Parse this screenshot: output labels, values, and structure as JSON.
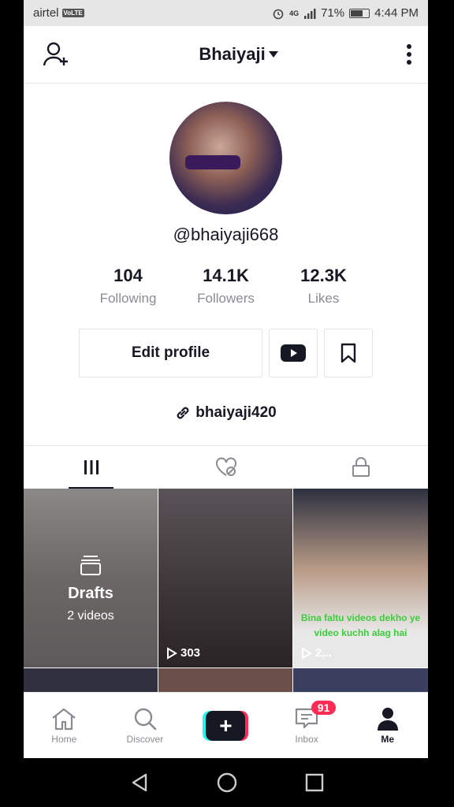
{
  "status": {
    "carrier": "airtel",
    "volte": "VoLTE",
    "network": "4G",
    "battery": "71%",
    "battery_level": 0.71,
    "time": "4:44 PM"
  },
  "header": {
    "title": "Bhaiyaji"
  },
  "profile": {
    "handle": "@bhaiyaji668",
    "stats": [
      {
        "value": "104",
        "label": "Following"
      },
      {
        "value": "14.1K",
        "label": "Followers"
      },
      {
        "value": "12.3K",
        "label": "Likes"
      }
    ],
    "edit_label": "Edit profile",
    "link": "bhaiyaji420"
  },
  "grid": {
    "drafts": {
      "title": "Drafts",
      "count": "2 videos"
    },
    "videos": [
      {
        "views": "303"
      },
      {
        "views": "2,..",
        "caption": "Bina faltu videos dekho ye video kuchh alag hai"
      }
    ]
  },
  "nav": {
    "items": [
      {
        "label": "Home"
      },
      {
        "label": "Discover"
      },
      {
        "label": ""
      },
      {
        "label": "Inbox",
        "badge": "91"
      },
      {
        "label": "Me"
      }
    ]
  },
  "colors": {
    "accent": "#fe2c55",
    "cyan": "#25f4ee",
    "text": "#161823"
  }
}
